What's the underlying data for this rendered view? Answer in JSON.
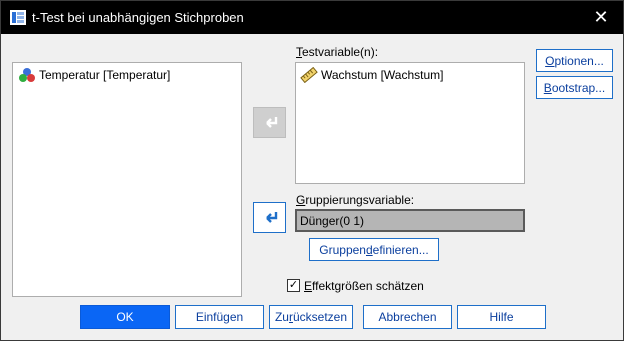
{
  "window": {
    "title": "t-Test bei unabhängigen Stichproben",
    "close_symbol": "✕"
  },
  "source_list": {
    "items": [
      {
        "label": "Temperatur [Temperatur]",
        "icon": "nominal-variable-icon"
      }
    ]
  },
  "test_variables": {
    "label_prefix": "",
    "label_mnemonic": "T",
    "label_rest": "estvariable(n):",
    "items": [
      {
        "label": "Wachstum [Wachstum]",
        "icon": "scale-ruler-icon"
      }
    ]
  },
  "grouping": {
    "label_mnemonic": "G",
    "label_rest": "ruppierungsvariable:",
    "value": "Dünger(0 1)",
    "define_groups_pre": "Gruppen ",
    "define_groups_mnemonic": "d",
    "define_groups_post": "efinieren..."
  },
  "side_buttons": {
    "options_mnemonic": "O",
    "options_rest": "ptionen...",
    "bootstrap_mnemonic": "B",
    "bootstrap_rest": "ootstrap..."
  },
  "effect_size": {
    "checked": true,
    "check_mark": "✓",
    "label_mnemonic": "E",
    "label_rest": "ffektgrößen schätzen"
  },
  "footer": {
    "ok": "OK",
    "paste": "Einfügen",
    "reset_pre": "Zu",
    "reset_mnemonic": "r",
    "reset_post": "ücksetzen",
    "cancel": "Abbrechen",
    "help": "Hilfe"
  },
  "colors": {
    "primary_button": "#0a66f5",
    "button_border": "#1e6fc9",
    "titlebar": "#000000"
  }
}
